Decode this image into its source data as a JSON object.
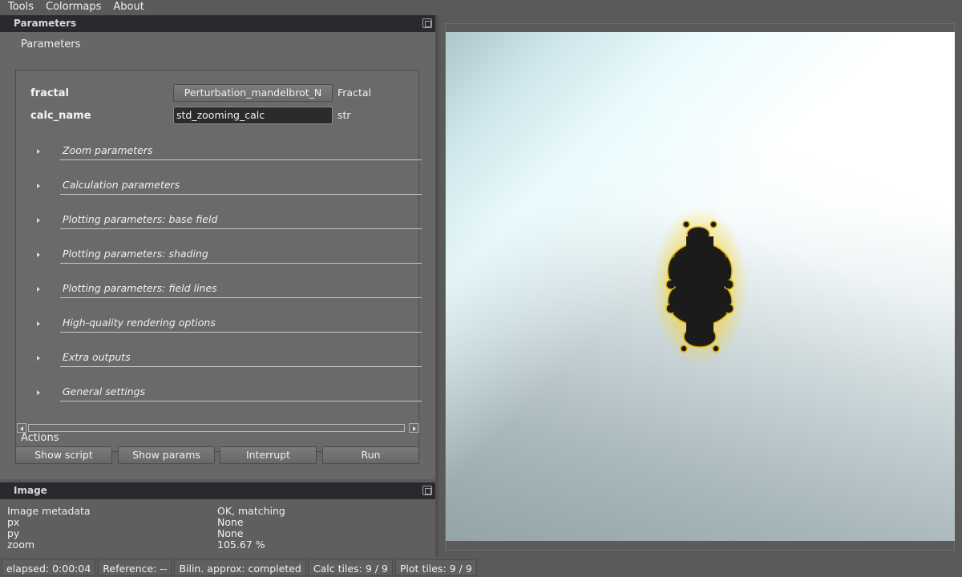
{
  "menubar": {
    "items": [
      "Tools",
      "Colormaps",
      "About"
    ]
  },
  "params_dock": {
    "title": "Parameters",
    "group_title": "Parameters",
    "fields": [
      {
        "label": "fractal",
        "value": "Perturbation_mandelbrot_N",
        "type": "Fractal"
      },
      {
        "label": "calc_name",
        "value": "std_zooming_calc",
        "type": "str"
      }
    ],
    "sections": [
      "Zoom parameters",
      "Calculation parameters",
      "Plotting parameters: base field",
      "Plotting parameters: shading",
      "Plotting parameters: field lines",
      "High-quality rendering options",
      "Extra outputs",
      "General settings"
    ],
    "actions_title": "Actions",
    "actions": [
      "Show script",
      "Show params",
      "Interrupt",
      "Run"
    ]
  },
  "image_dock": {
    "title": "Image",
    "rows": [
      {
        "key": "Image metadata",
        "value": "OK, matching"
      },
      {
        "key": "px",
        "value": "None"
      },
      {
        "key": "py",
        "value": "None"
      },
      {
        "key": "zoom",
        "value": "105.67 %"
      }
    ]
  },
  "statusbar": {
    "items": [
      "elapsed: 0:00:04",
      "Reference: --",
      "Bilin. approx: completed",
      "Calc tiles: 9 / 9",
      "Plot tiles: 9 / 9"
    ]
  },
  "colors": {
    "background": "#5a5a5a",
    "dock_title": "#2a2a2e",
    "set_fill": "#1a1a1a",
    "set_glow": "#f5d21a"
  }
}
